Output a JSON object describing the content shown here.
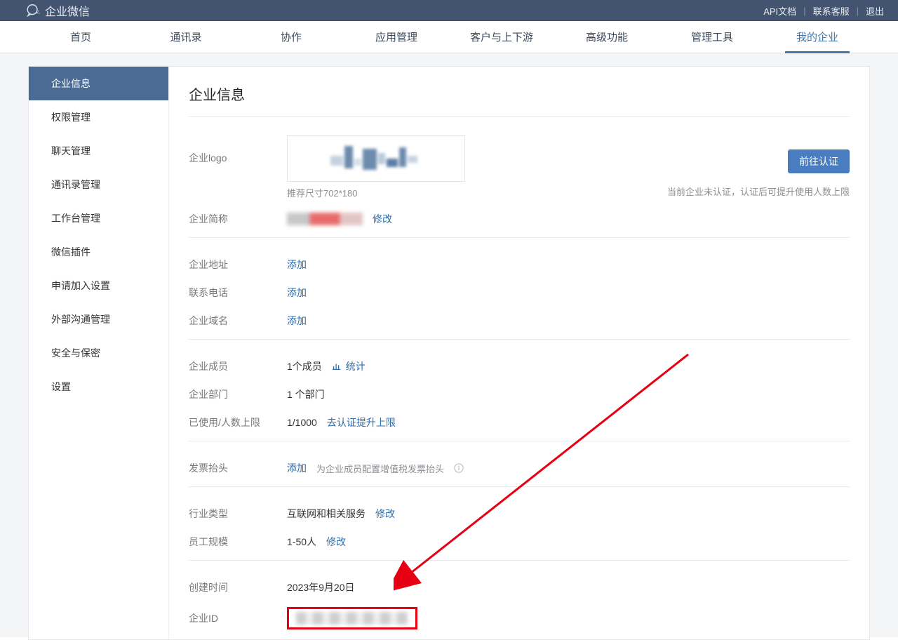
{
  "brand": "企业微信",
  "top_links": {
    "api": "API文档",
    "contact": "联系客服",
    "logout": "退出"
  },
  "nav": [
    "首页",
    "通讯录",
    "协作",
    "应用管理",
    "客户与上下游",
    "高级功能",
    "管理工具",
    "我的企业"
  ],
  "nav_active_index": 7,
  "side": [
    "企业信息",
    "权限管理",
    "聊天管理",
    "通讯录管理",
    "工作台管理",
    "微信插件",
    "申请加入设置",
    "外部沟通管理",
    "安全与保密",
    "设置"
  ],
  "side_active_index": 0,
  "title": "企业信息",
  "logo": {
    "label": "企业logo",
    "hint": "推荐尺寸702*180"
  },
  "short_name": {
    "label": "企业简称",
    "action": "修改"
  },
  "cert": {
    "button": "前往认证",
    "note": "当前企业未认证，认证后可提升使用人数上限"
  },
  "addr": {
    "label": "企业地址",
    "action": "添加"
  },
  "phone": {
    "label": "联系电话",
    "action": "添加"
  },
  "domain": {
    "label": "企业域名",
    "action": "添加"
  },
  "members": {
    "label": "企业成员",
    "value": "1个成员",
    "stats": "统计"
  },
  "depts": {
    "label": "企业部门",
    "value": "1 个部门"
  },
  "quota": {
    "label": "已使用/人数上限",
    "value": "1/1000",
    "action": "去认证提升上限"
  },
  "invoice": {
    "label": "发票抬头",
    "action": "添加",
    "hint": "为企业成员配置增值税发票抬头"
  },
  "industry": {
    "label": "行业类型",
    "value": "互联网和相关服务",
    "action": "修改"
  },
  "scale": {
    "label": "员工规模",
    "value": "1-50人",
    "action": "修改"
  },
  "created": {
    "label": "创建时间",
    "value": "2023年9月20日"
  },
  "corpid": {
    "label": "企业ID"
  }
}
